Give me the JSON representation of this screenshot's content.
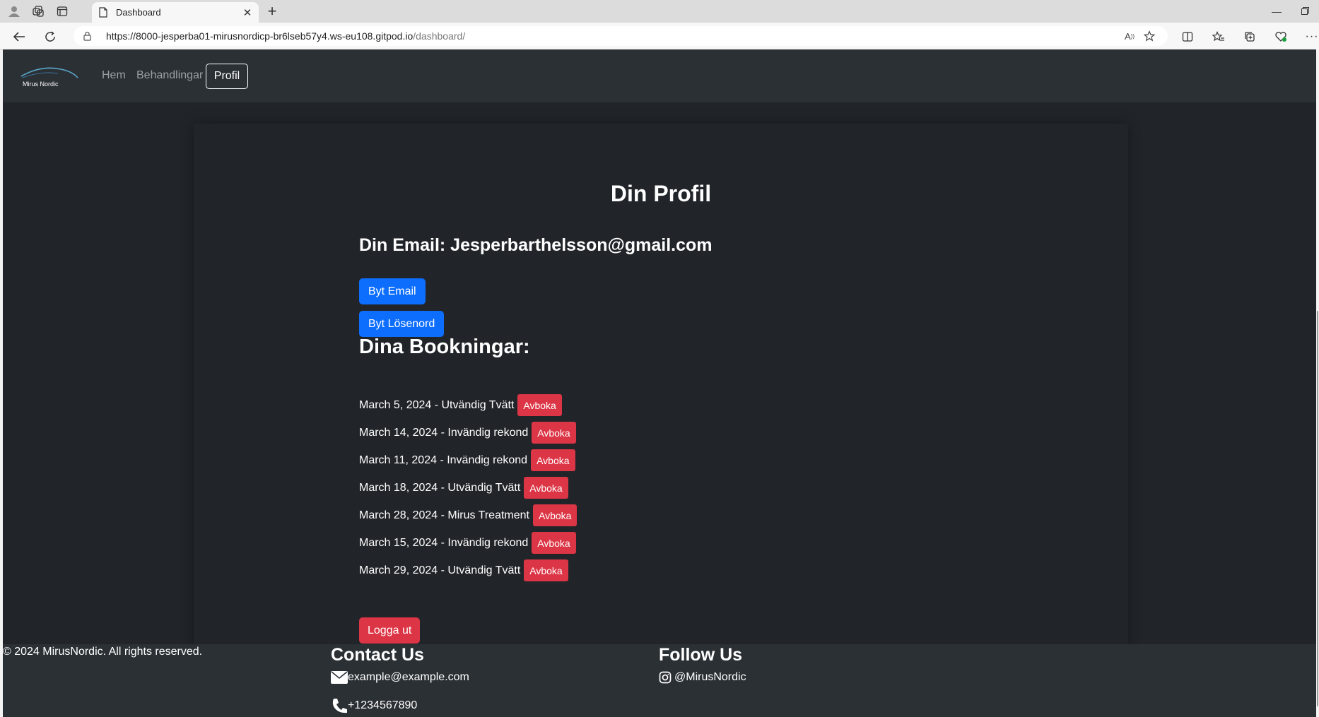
{
  "browser": {
    "tab_title": "Dashboard",
    "url_host": "https://8000-jesperba01-mirusnordicp-br6lseb57y4.ws-eu108.gitpod.io",
    "url_path": "/dashboard/",
    "icons": [
      "profile-icon",
      "workspaces-icon",
      "tab-actions-icon",
      "doc-icon",
      "close-icon",
      "new-tab-icon",
      "minimize-icon",
      "restore-icon",
      "back-icon",
      "reload-icon",
      "lock-icon",
      "read-aloud-icon",
      "favorite-icon",
      "split-screen-icon",
      "favorites-icon",
      "collections-icon",
      "browser-essentials-icon",
      "more-icon"
    ]
  },
  "navbar": {
    "logo_text": "Mirus Nordic",
    "links": [
      "Hem",
      "Behandlingar"
    ],
    "active": "Profil"
  },
  "profile": {
    "title": "Din Profil",
    "email_label": "Din Email: Jesperbarthelsson@gmail.com",
    "change_email": "Byt Email",
    "change_password": "Byt Lösenord",
    "bookings_heading": "Dina Bookningar:",
    "cancel_label": "Avboka",
    "bookings": [
      "March 5, 2024 - Utvändig Tvätt",
      "March 14, 2024 - Invändig rekond",
      "March 11, 2024 - Invändig rekond",
      "March 18, 2024 - Utvändig Tvätt",
      "March 28, 2024 - Mirus Treatment",
      "March 15, 2024 - Invändig rekond",
      "March 29, 2024 - Utvändig Tvätt"
    ],
    "logout": "Logga ut"
  },
  "footer": {
    "copyright": "© 2024 MirusNordic. All rights reserved.",
    "contact_heading": "Contact Us",
    "email": "example@example.com",
    "phone": "+1234567890",
    "follow_heading": "Follow Us",
    "instagram": "@MirusNordic"
  },
  "colors": {
    "page_bg": "#212529",
    "navbar_bg": "#2b3035",
    "primary": "#0d6efd",
    "danger": "#dc3545"
  }
}
